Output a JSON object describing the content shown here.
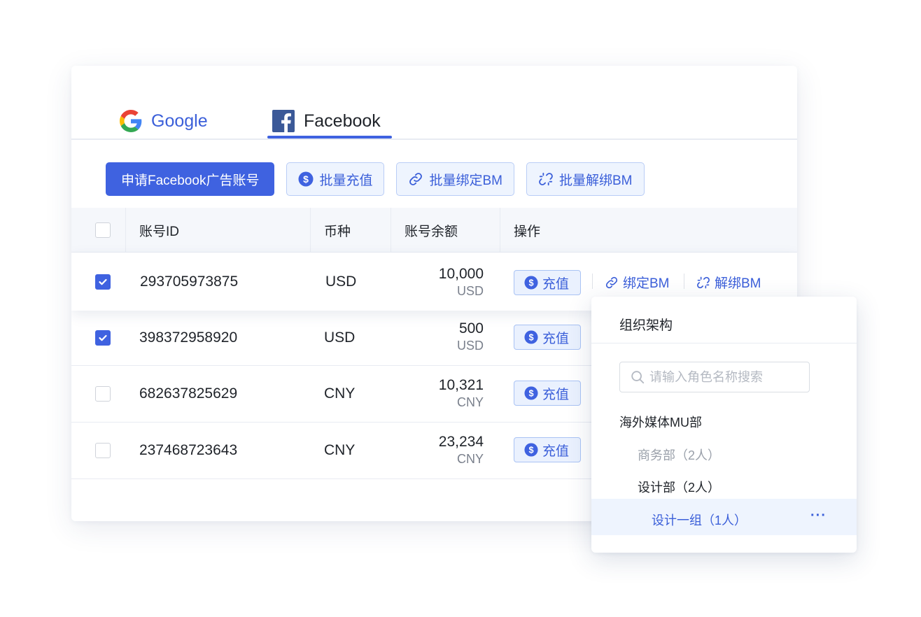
{
  "tabs": [
    {
      "label": "Google",
      "active": false
    },
    {
      "label": "Facebook",
      "active": true
    }
  ],
  "toolbar": {
    "apply_label": "申请Facebook广告账号",
    "batch_recharge_label": "批量充值",
    "batch_bind_label": "批量绑定BM",
    "batch_unbind_label": "批量解绑BM"
  },
  "table": {
    "columns": [
      "账号ID",
      "币种",
      "账号余额",
      "操作"
    ],
    "rows": [
      {
        "checked": true,
        "id": "293705973875",
        "currency": "USD",
        "balance": "10,000",
        "balance_currency": "USD"
      },
      {
        "checked": true,
        "id": "398372958920",
        "currency": "USD",
        "balance": "500",
        "balance_currency": "USD"
      },
      {
        "checked": false,
        "id": "682637825629",
        "currency": "CNY",
        "balance": "10,321",
        "balance_currency": "CNY"
      },
      {
        "checked": false,
        "id": "237468723643",
        "currency": "CNY",
        "balance": "23,234",
        "balance_currency": "CNY"
      }
    ],
    "actions": {
      "recharge_label": "充值",
      "bind_label": "绑定BM",
      "unbind_label": "解绑BM"
    }
  },
  "org_panel": {
    "title": "组织架构",
    "search_placeholder": "请输入角色名称搜索",
    "tree": [
      {
        "label": "海外媒体MU部",
        "level": 0,
        "muted": false
      },
      {
        "label": "商务部（2人）",
        "level": 1,
        "muted": true
      },
      {
        "label": "设计部（2人）",
        "level": 1,
        "muted": false
      },
      {
        "label": "设计一组（1人）",
        "level": 2,
        "selected": true
      }
    ],
    "more_label": "···"
  },
  "colors": {
    "primary": "#3f62e0",
    "link": "#3b5fd9",
    "ghost_bg": "#eef4fe",
    "header_bg": "#f5f7fb",
    "facebook_blue": "#3b5998"
  }
}
